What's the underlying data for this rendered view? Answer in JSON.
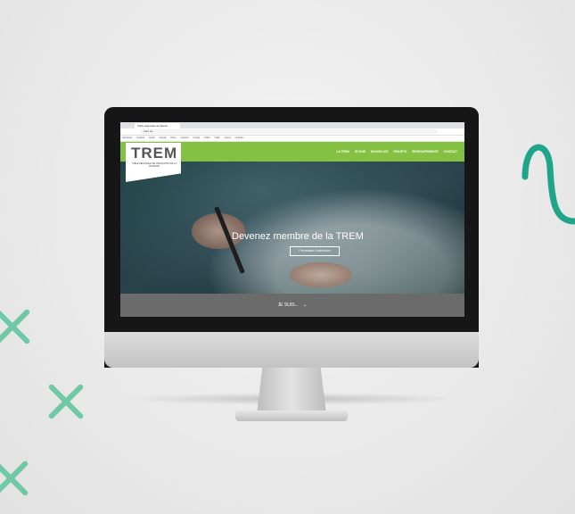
{
  "browser": {
    "tab_title": "Table régionale de l'Estrie",
    "url": "trem.ca",
    "bookmarks": [
      "Facebook",
      "Outlook",
      "Gmail",
      "Google",
      "Drive",
      "Youtube",
      "Feedly",
      "Outils",
      "Trello",
      "Canva",
      "LinkedIn"
    ]
  },
  "site": {
    "logo_text": "TREM",
    "logo_subtitle": "Table régionale de l'éducation de la Mauricie",
    "menu_items": [
      "La TREM",
      "Je suis",
      "Nouvelles",
      "Projets",
      "Regroupements",
      "Contact"
    ],
    "hero_headline": "Devenez membre de la TREM",
    "cta_label": "Formulaire d'adhésion",
    "strip_label": "JE SUIS..."
  },
  "colors": {
    "brand_green": "#84c142",
    "deco_teal": "#1fa58a",
    "deco_cross": "#6fc9a7"
  },
  "icons": {
    "strip_icon": "chevron-down-circle-icon"
  }
}
